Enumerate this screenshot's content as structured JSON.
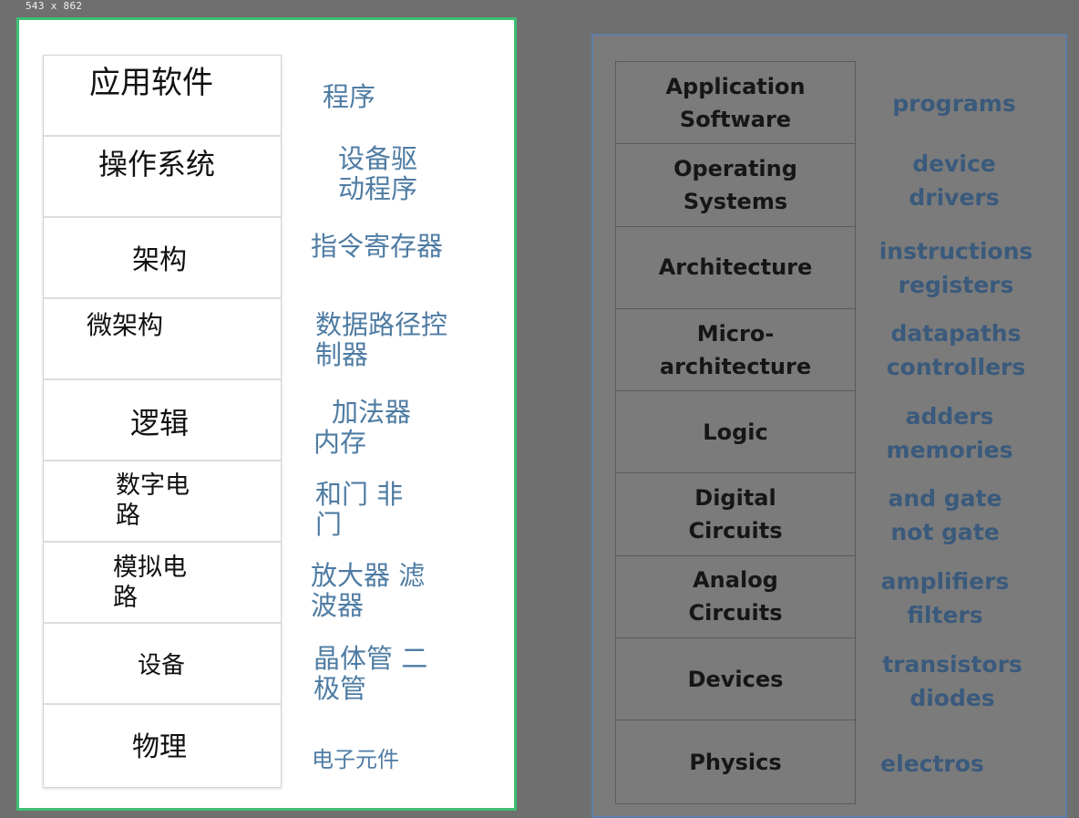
{
  "canvas": {
    "dimension_label": "543 x 862"
  },
  "left_panel": {
    "levels": [
      {
        "label": "应用软件",
        "desc": "程序"
      },
      {
        "label": "操作系统",
        "desc": "设备驱\n动程序"
      },
      {
        "label": "架构",
        "desc": "指令寄存器"
      },
      {
        "label": "微架构",
        "desc": "数据路径控\n制器"
      },
      {
        "label": "逻辑",
        "desc": "加法器\n内存"
      },
      {
        "label": "数字电\n路",
        "desc": "和门 非\n门"
      },
      {
        "label": "模拟电\n路",
        "desc": "放大器 滤\n波器"
      },
      {
        "label": "设备",
        "desc": "晶体管 二\n极管"
      },
      {
        "label": "物理",
        "desc": "电子元件"
      }
    ]
  },
  "right_panel": {
    "levels": [
      {
        "label": "Application\nSoftware",
        "desc": "programs"
      },
      {
        "label": "Operating\nSystems",
        "desc": "device\ndrivers"
      },
      {
        "label": "Architecture",
        "desc": "instructions\nregisters"
      },
      {
        "label": "Micro-\narchitecture",
        "desc": "datapaths\ncontrollers"
      },
      {
        "label": "Logic",
        "desc": "adders\nmemories"
      },
      {
        "label": "Digital\nCircuits",
        "desc": "and  gate\nnot gate"
      },
      {
        "label": "Analog\nCircuits",
        "desc": "amplifiers\nfilters"
      },
      {
        "label": "Devices",
        "desc": "transistors\ndiodes"
      },
      {
        "label": "Physics",
        "desc": "electros"
      }
    ]
  },
  "colors": {
    "background": "#6f6f6f",
    "selection_border": "#3fbf73",
    "left_desc_text": "#4f7ca3",
    "right_desc_text": "#3a5a7c"
  }
}
